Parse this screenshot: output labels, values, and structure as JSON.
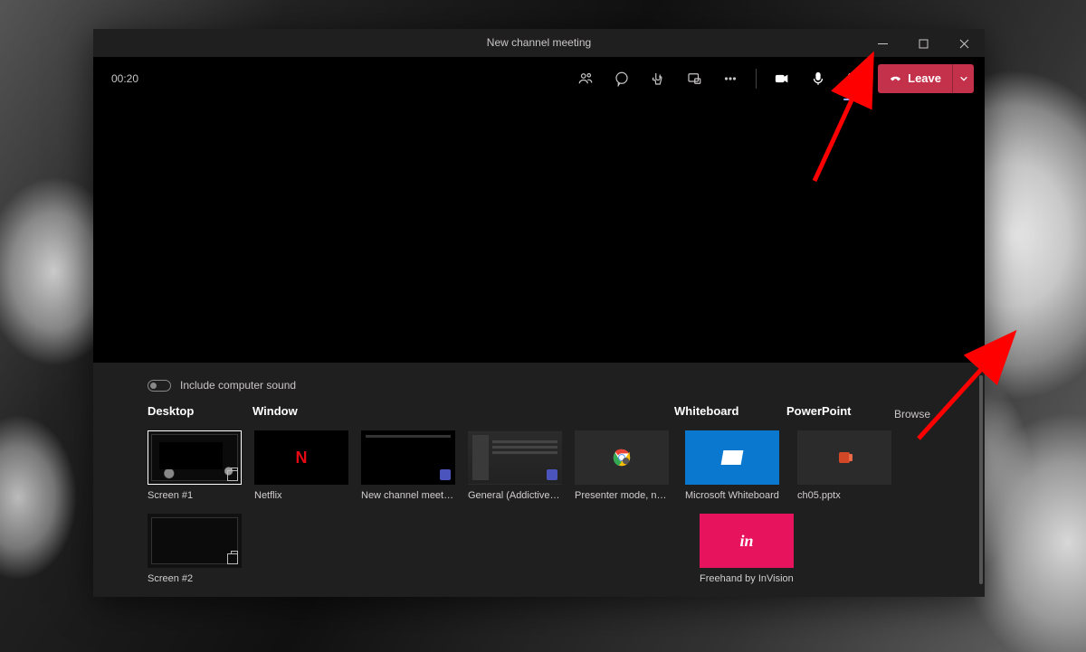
{
  "window": {
    "title": "New channel meeting"
  },
  "call": {
    "timer": "00:20",
    "leave_label": "Leave"
  },
  "share_tray": {
    "include_sound_label": "Include computer sound",
    "headings": {
      "desktop": "Desktop",
      "window": "Window",
      "whiteboard": "Whiteboard",
      "powerpoint": "PowerPoint"
    },
    "browse_label": "Browse",
    "tiles": {
      "screen1": "Screen #1",
      "screen2": "Screen #2",
      "netflix": "Netflix",
      "new_channel": "New channel meeting | …",
      "general": "General (AddictiveTips - …",
      "presenter": "Presenter mode, notes a…",
      "ms_whiteboard": "Microsoft Whiteboard",
      "invision": "Freehand by InVision",
      "ppt_file": "ch05.pptx"
    }
  }
}
